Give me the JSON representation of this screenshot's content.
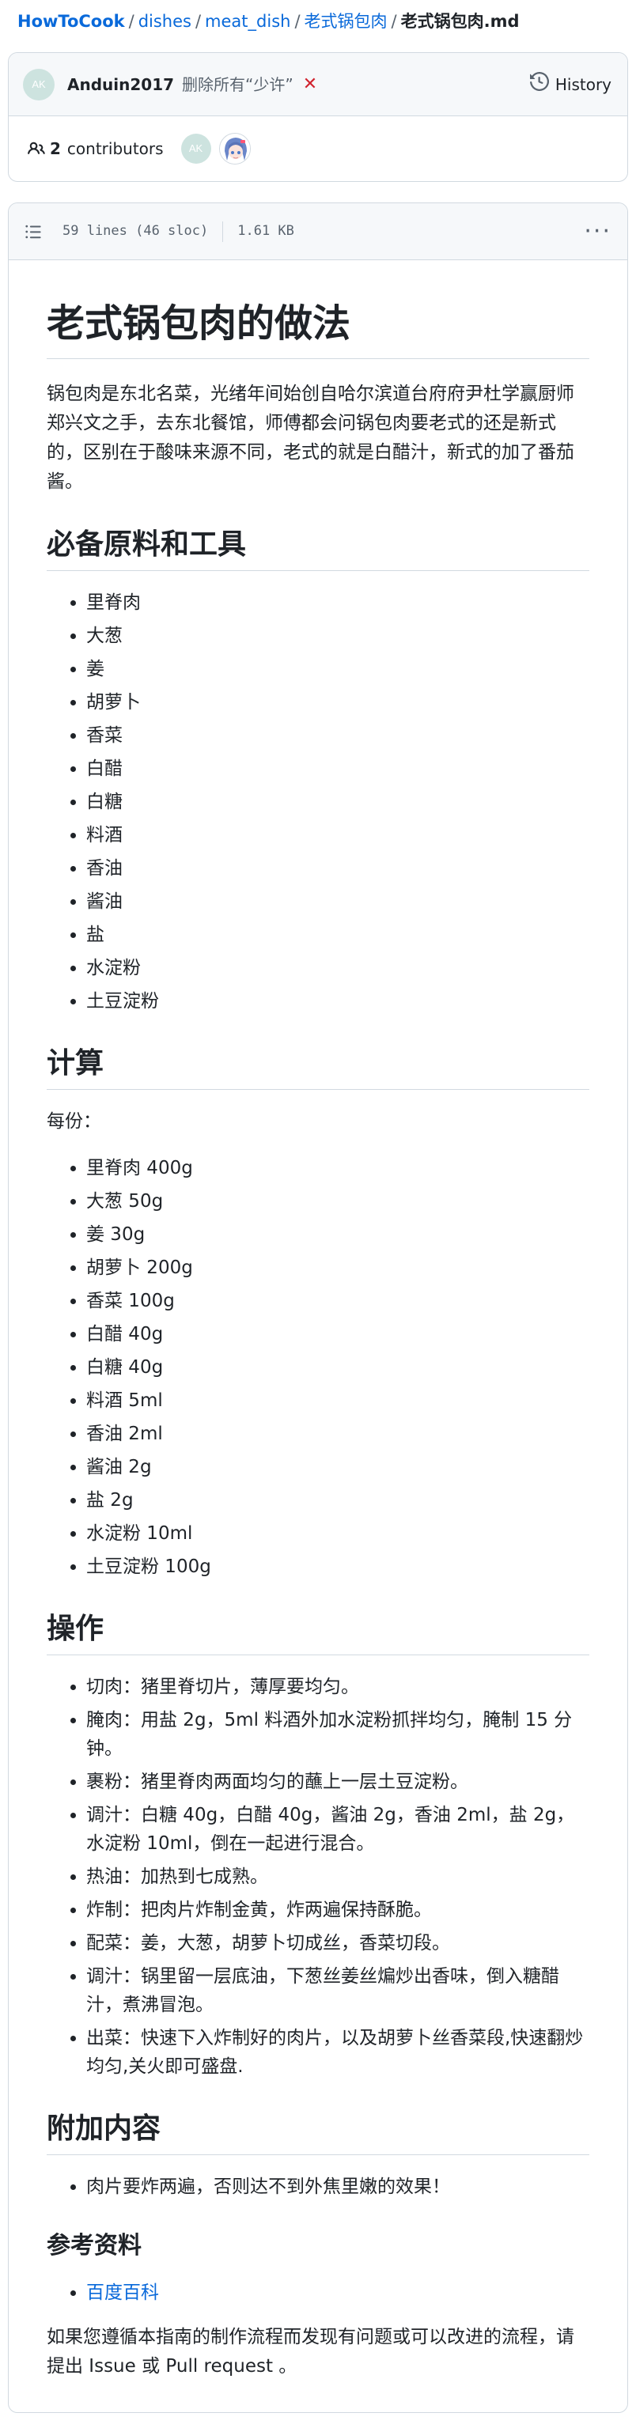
{
  "breadcrumb": {
    "repo": "HowToCook",
    "items": [
      "dishes",
      "meat_dish",
      "老式锅包肉"
    ],
    "current": "老式锅包肉.md",
    "separator": "/"
  },
  "commit": {
    "avatar_initials": "AK",
    "author": "Anduin2017",
    "message": "删除所有“少许”",
    "status": "✕",
    "history_label": "History"
  },
  "contributors": {
    "count": "2",
    "label": "contributors",
    "avatar_initials": "AK"
  },
  "file": {
    "lines_info": "59 lines (46 sloc)",
    "size": "1.61 KB",
    "more_label": "···"
  },
  "doc": {
    "title": "老式锅包肉的做法",
    "intro": "锅包肉是东北名菜，光绪年间始创自哈尔滨道台府府尹杜学赢厨师郑兴文之手，去东北餐馆，师傅都会问锅包肉要老式的还是新式的，区别在于酸味来源不同，老式的就是白醋汁，新式的加了番茄酱。",
    "ingredients_heading": "必备原料和工具",
    "ingredients": [
      "里脊肉",
      "大葱",
      "姜",
      "胡萝卜",
      "香菜",
      "白醋",
      "白糖",
      "料酒",
      "香油",
      "酱油",
      "盐",
      "水淀粉",
      "土豆淀粉"
    ],
    "calc_heading": "计算",
    "calc_intro": "每份：",
    "amounts": [
      "里脊肉 400g",
      "大葱 50g",
      "姜 30g",
      "胡萝卜 200g",
      "香菜 100g",
      "白醋 40g",
      "白糖 40g",
      "料酒 5ml",
      "香油 2ml",
      "酱油 2g",
      "盐 2g",
      "水淀粉 10ml",
      "土豆淀粉 100g"
    ],
    "ops_heading": "操作",
    "steps": [
      "切肉：猪里脊切片，薄厚要均匀。",
      "腌肉：用盐 2g，5ml 料酒外加水淀粉抓拌均匀，腌制 15 分钟。",
      "裹粉：猪里脊肉两面均匀的蘸上一层土豆淀粉。",
      "调汁：白糖 40g，白醋 40g，酱油 2g，香油 2ml，盐 2g，水淀粉 10ml，倒在一起进行混合。",
      "热油：加热到七成熟。",
      "炸制：把肉片炸制金黄，炸两遍保持酥脆。",
      "配菜：姜，大葱，胡萝卜切成丝，香菜切段。",
      "调汁：锅里留一层底油，下葱丝姜丝煸炒出香味，倒入糖醋汁，煮沸冒泡。",
      "出菜：快速下入炸制好的肉片，以及胡萝卜丝香菜段,快速翻炒均匀,关火即可盛盘."
    ],
    "extra_heading": "附加内容",
    "extras": [
      "肉片要炸两遍，否则达不到外焦里嫩的效果！"
    ],
    "refs_heading": "参考资料",
    "refs": [
      "百度百科"
    ],
    "footer": "如果您遵循本指南的制作流程而发现有问题或可以改进的流程，请提出 Issue 或 Pull request 。"
  }
}
